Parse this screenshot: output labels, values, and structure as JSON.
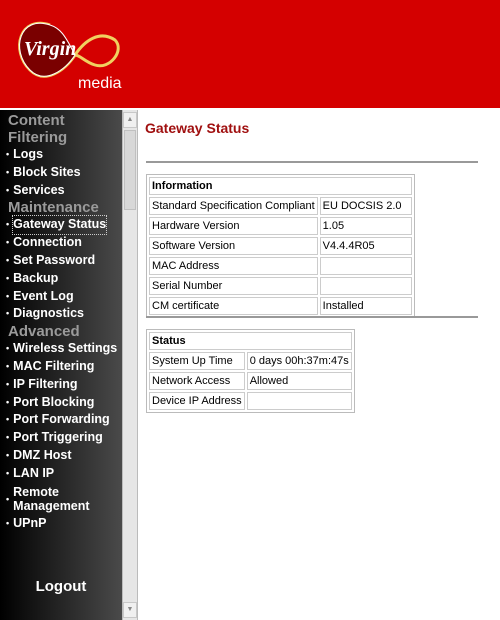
{
  "brand": {
    "name": "Virgin",
    "sub": "media",
    "header_color": "#d40000"
  },
  "sidebar": {
    "sections": [
      {
        "title": "Content Filtering",
        "items": [
          "Logs",
          "Block Sites",
          "Services"
        ]
      },
      {
        "title": "Maintenance",
        "items": [
          "Gateway Status",
          "Connection",
          "Set Password",
          "Backup",
          "Event Log",
          "Diagnostics"
        ]
      },
      {
        "title": "Advanced",
        "items": [
          "Wireless Settings",
          "MAC Filtering",
          "IP Filtering",
          "Port Blocking",
          "Port Forwarding",
          "Port Triggering",
          "DMZ Host",
          "LAN IP",
          "Remote Management",
          "UPnP"
        ]
      }
    ],
    "active": "Gateway Status",
    "logout": "Logout"
  },
  "main": {
    "title": "Gateway Status",
    "information": {
      "heading": "Information",
      "rows": [
        {
          "label": "Standard Specification Compliant",
          "value": "EU DOCSIS 2.0"
        },
        {
          "label": "Hardware Version",
          "value": "1.05"
        },
        {
          "label": "Software Version",
          "value": "V4.4.4R05"
        },
        {
          "label": "MAC Address",
          "value": ""
        },
        {
          "label": "Serial Number",
          "value": ""
        },
        {
          "label": "CM certificate",
          "value": "Installed"
        }
      ]
    },
    "status": {
      "heading": "Status",
      "rows": [
        {
          "label": "System Up Time",
          "value": "0 days 00h:37m:47s"
        },
        {
          "label": "Network Access",
          "value": "Allowed"
        },
        {
          "label": "Device IP Address",
          "value": ""
        }
      ]
    }
  }
}
